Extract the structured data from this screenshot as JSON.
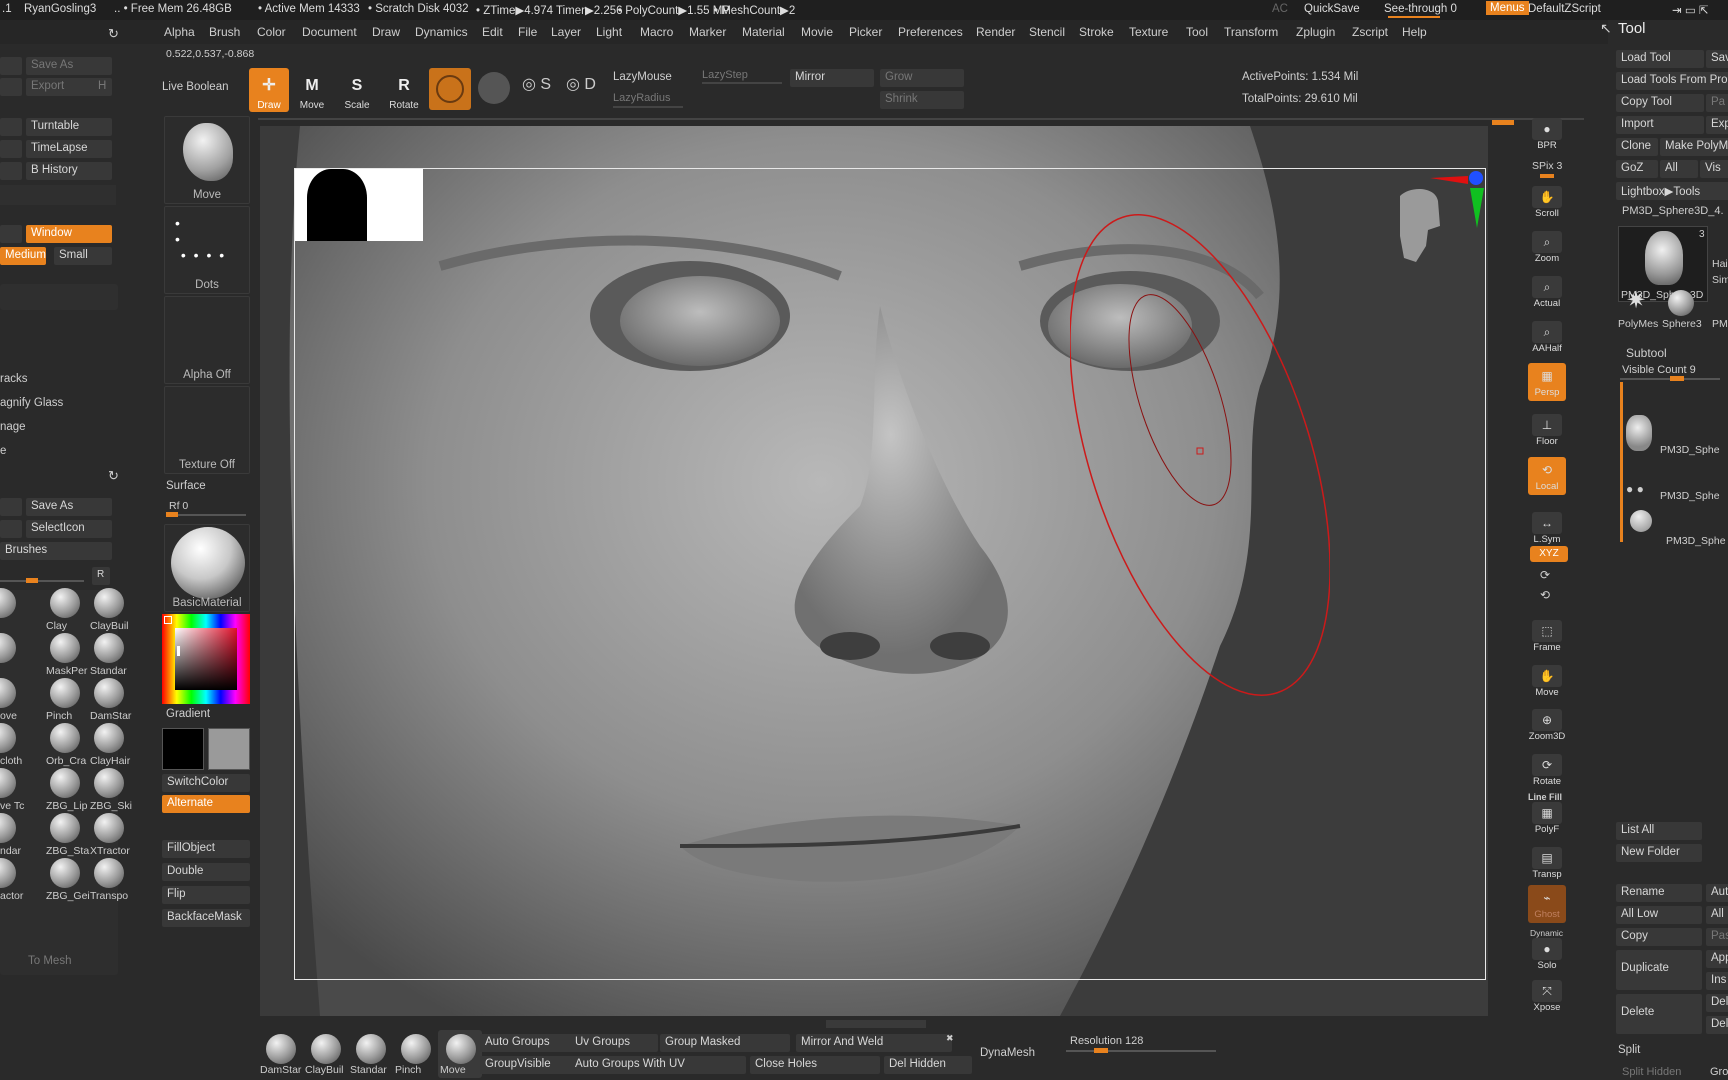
{
  "topbar": {
    "doc_prefix": ".1",
    "doc_name": "RyanGosling3",
    "free_mem": ".. • Free Mem 26.48GB",
    "active_mem": "• Active Mem 14333",
    "scratch": "• Scratch Disk 4032",
    "ztime": "• ZTime▶4.974 Timer▶2.256",
    "polycount": "• PolyCount▶1.55 MP",
    "meshcount": "• MeshCount▶2",
    "ac": "AC",
    "quicksave": "QuickSave",
    "see_through": "See-through  0",
    "menus": "Menus",
    "default_zscript": "DefaultZScript"
  },
  "menus": [
    "Alpha",
    "Brush",
    "Color",
    "Document",
    "Draw",
    "Dynamics",
    "Edit",
    "File",
    "Layer",
    "Light",
    "Macro",
    "Marker",
    "Material",
    "Movie",
    "Picker",
    "Preferences",
    "Render",
    "Stencil",
    "Stroke",
    "Texture",
    "Tool",
    "Transform",
    "Zplugin",
    "Zscript",
    "Help"
  ],
  "coords": "0.522,0.537,-0.868",
  "toolbar": {
    "live_boolean": "Live Boolean",
    "draw": "Draw",
    "move": "Move",
    "scale": "Scale",
    "rotate": "Rotate",
    "draw_glyph": "✛",
    "move_glyph": "M",
    "scale_glyph": "S",
    "rotate_glyph": "R",
    "lazymouse": "LazyMouse",
    "lazystep": "LazyStep",
    "lazyradius": "LazyRadius",
    "mirror": "Mirror",
    "grow": "Grow",
    "shrink": "Shrink",
    "active_points": "ActivePoints: 1.534 Mil",
    "total_points": "TotalPoints: 29.610 Mil"
  },
  "left_panel": {
    "save_as_top": "Save As",
    "export": "Export",
    "h": "H",
    "turntable": "Turntable",
    "timelapse": "TimeLapse",
    "b_history": "B History",
    "window": "Window",
    "medium": "Medium",
    "small": "Small",
    "tracks": "racks",
    "magnify": "agnify Glass",
    "image": "nage",
    "e": "e",
    "save_as": "Save As",
    "select_icon": "SelectIcon",
    "brushes": "Brushes",
    "r": "R",
    "to_mesh": "To Mesh"
  },
  "brushes": [
    {
      "label": ""
    },
    {
      "label": "Clay"
    },
    {
      "label": "ClayBuil"
    },
    {
      "label": ""
    },
    {
      "label": "MaskPer"
    },
    {
      "label": "Standar"
    },
    {
      "label": "ove"
    },
    {
      "label": "Pinch"
    },
    {
      "label": "DamStar"
    },
    {
      "label": "cloth"
    },
    {
      "label": "Orb_Cra"
    },
    {
      "label": "ClayHair"
    },
    {
      "label": "ve Tc"
    },
    {
      "label": "ZBG_Lip"
    },
    {
      "label": "ZBG_Ski"
    },
    {
      "label": "ndar"
    },
    {
      "label": "ZBG_Sta"
    },
    {
      "label": "XTractor"
    },
    {
      "label": "actor"
    },
    {
      "label": "ZBG_Gei"
    },
    {
      "label": "Transpo"
    }
  ],
  "mid_panel": {
    "move": "Move",
    "dots": "Dots",
    "alpha_off": "Alpha Off",
    "texture_off": "Texture Off",
    "surface": "Surface",
    "rf": "Rf 0",
    "basic_material": "BasicMaterial",
    "gradient": "Gradient",
    "switch_color": "SwitchColor",
    "alternate": "Alternate",
    "fill_object": "FillObject",
    "double": "Double",
    "flip": "Flip",
    "backface_mask": "BackfaceMask"
  },
  "right_icons": {
    "bpr": "BPR",
    "spix": "SPix 3",
    "scroll": "Scroll",
    "zoom": "Zoom",
    "actual": "Actual",
    "aahalf": "AAHalf",
    "persp": "Persp",
    "floor": "Floor",
    "local": "Local",
    "lsym": "L.Sym",
    "xyz": "XYZ",
    "frame": "Frame",
    "move": "Move",
    "zoom3d": "Zoom3D",
    "rotate": "Rotate",
    "line_fill": "Line Fill",
    "polyf": "PolyF",
    "transp": "Transp",
    "ghost": "Ghost",
    "dynamic": "Dynamic",
    "solo": "Solo",
    "xpose": "Xpose"
  },
  "tool_panel": {
    "title": "Tool",
    "load_tool": "Load Tool",
    "sav": "Sav",
    "load_tools_from": "Load Tools From Pro",
    "copy_tool": "Copy Tool",
    "pa": "Pa",
    "import": "Import",
    "exp": "Exp",
    "clone": "Clone",
    "make_poly": "Make PolyM",
    "goz": "GoZ",
    "all": "All",
    "vis": "Vis",
    "lightbox_tools": "Lightbox▶Tools",
    "current_tool": "PM3D_Sphere3D_4.",
    "thumb_count": "3",
    "thumb_label": "PM3D_Sphere3D",
    "hai": "Hai",
    "sim": "Sim",
    "polymesh": "PolyMes",
    "sphere3": "Sphere3",
    "pm": "PM",
    "subtool": "Subtool",
    "visible_count": "Visible Count 9",
    "subtools": [
      "PM3D_Sphe",
      "PM3D_Sphe",
      "PM3D_Sphe"
    ],
    "list_all": "List All",
    "new_folder": "New Folder",
    "rename": "Rename",
    "aut": "Aut",
    "all_low": "All Low",
    "all2": "All",
    "copy": "Copy",
    "pas": "Pas",
    "duplicate": "Duplicate",
    "app": "App",
    "ins": "Ins",
    "delete": "Delete",
    "del": "Del",
    "del2": "Del",
    "split": "Split",
    "split_hidden": "Split Hidden",
    "gro": "Gro"
  },
  "bottom": {
    "brushes": [
      "DamStar",
      "ClayBuil",
      "Standar",
      "Pinch",
      "Move"
    ],
    "auto_groups": "Auto Groups",
    "uv_groups": "Uv Groups",
    "group_masked": "Group Masked",
    "mirror_weld": "Mirror And Weld",
    "group_visible": "GroupVisible",
    "auto_groups_uv": "Auto Groups With UV",
    "close_holes": "Close Holes",
    "del_hidden": "Del Hidden",
    "dynamesh": "DynaMesh",
    "resolution": "Resolution 128"
  },
  "colors": {
    "accent": "#e8821e",
    "panel": "#333333",
    "bg": "#2a2a2a"
  }
}
